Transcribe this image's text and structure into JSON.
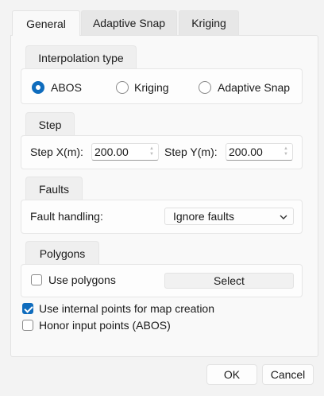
{
  "tabs": [
    {
      "label": "General",
      "active": true
    },
    {
      "label": "Adaptive Snap",
      "active": false
    },
    {
      "label": "Kriging",
      "active": false
    }
  ],
  "interpolation": {
    "group_label": "Interpolation type",
    "options": [
      {
        "label": "ABOS",
        "checked": true
      },
      {
        "label": "Kriging",
        "checked": false
      },
      {
        "label": "Adaptive Snap",
        "checked": false
      }
    ]
  },
  "step": {
    "group_label": "Step",
    "x_label": "Step X(m):",
    "x_value": "200.00",
    "y_label": "Step Y(m):",
    "y_value": "200.00"
  },
  "faults": {
    "group_label": "Faults",
    "handling_label": "Fault handling:",
    "handling_value": "Ignore faults"
  },
  "polygons": {
    "group_label": "Polygons",
    "use_label": "Use polygons",
    "use_checked": false,
    "select_label": "Select"
  },
  "options": {
    "internal_points_label": "Use internal points for map creation",
    "internal_points_checked": true,
    "honor_points_label": "Honor input points (ABOS)",
    "honor_points_checked": false
  },
  "footer": {
    "ok_label": "OK",
    "cancel_label": "Cancel"
  },
  "colors": {
    "accent": "#0f6cbd"
  }
}
